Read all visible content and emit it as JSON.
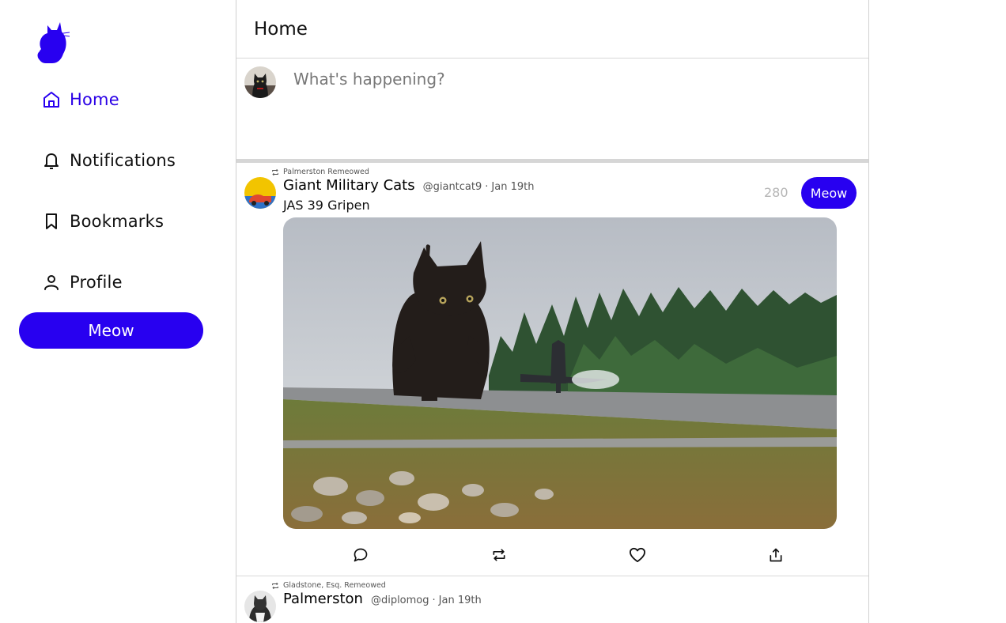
{
  "app": {
    "accent": "#2800f0",
    "brand_icon": "cat-logo-icon"
  },
  "sidebar": {
    "items": [
      {
        "label": "Home",
        "icon": "home-icon",
        "active": true
      },
      {
        "label": "Notifications",
        "icon": "bell-icon",
        "active": false
      },
      {
        "label": "Bookmarks",
        "icon": "bookmark-icon",
        "active": false
      },
      {
        "label": "Profile",
        "icon": "user-icon",
        "active": false
      }
    ],
    "meow_label": "Meow"
  },
  "header": {
    "title": "Home"
  },
  "composer": {
    "placeholder": "What's happening?",
    "char_count": "280",
    "submit_label": "Meow"
  },
  "posts": [
    {
      "remeowed_by": "Palmerston Remeowed",
      "display_name": "Giant Military Cats",
      "handle": "@giantcat9",
      "separator": "·",
      "date": "Jan 19th",
      "text": "JAS 39 Gripen",
      "actions": [
        "comment-icon",
        "remeow-icon",
        "like-icon",
        "share-icon"
      ]
    },
    {
      "remeowed_by": "Gladstone, Esq. Remeowed",
      "display_name": "Palmerston",
      "handle": "@diplomog",
      "separator": "·",
      "date": "Jan 19th"
    }
  ]
}
